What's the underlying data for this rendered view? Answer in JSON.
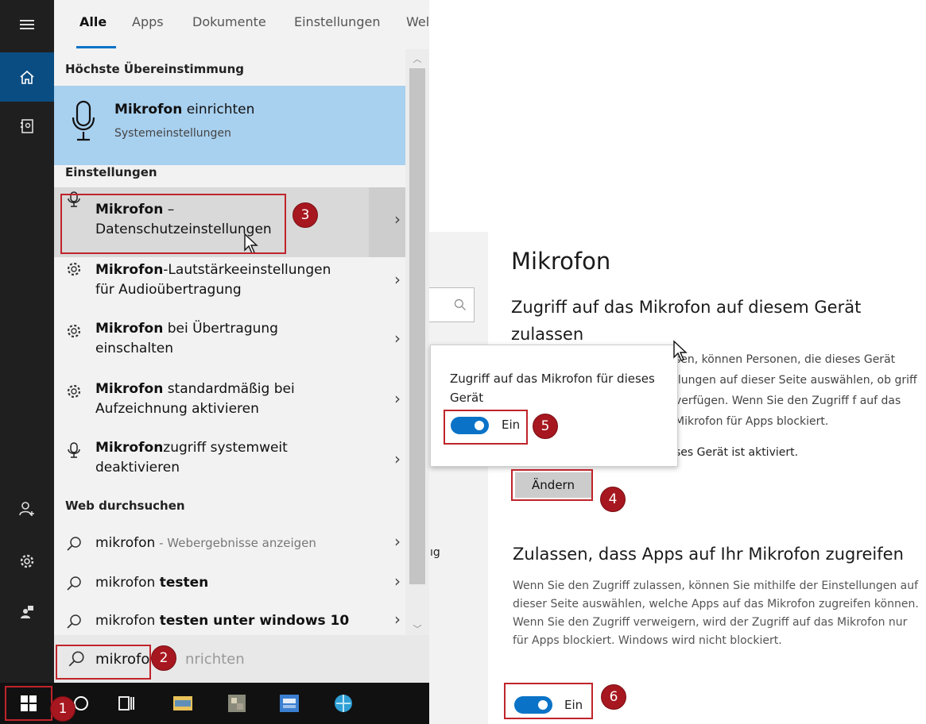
{
  "tabs": [
    {
      "label": "Alle",
      "active": true
    },
    {
      "label": "Apps"
    },
    {
      "label": "Dokumente"
    },
    {
      "label": "Einstellungen"
    },
    {
      "label": "Wel"
    }
  ],
  "best_match": {
    "section": "Höchste Übereinstimmung",
    "title_bold": "Mikrofon",
    "title_rest": " einrichten",
    "subtitle": "Systemeinstellungen",
    "icon": "microphone-icon"
  },
  "settings_section": "Einstellungen",
  "settings_results": [
    {
      "icon": "microphone-icon",
      "bold": "Mikrofon",
      "rest": " –",
      "line2": "Datenschutzeinstellungen"
    },
    {
      "icon": "gear-icon",
      "bold": "Mikrofon",
      "rest": "-Lautstärkeeinstellungen",
      "line2": "für Audioübertragung"
    },
    {
      "icon": "gear-icon",
      "bold": "Mikrofon",
      "rest": " bei Übertragung",
      "line2": "einschalten"
    },
    {
      "icon": "gear-icon",
      "bold": "Mikrofon",
      "rest": " standardmäßig bei",
      "line2": "Aufzeichnung aktivieren"
    },
    {
      "icon": "microphone-icon",
      "bold": "Mikrofon",
      "rest": "zugriff systemweit",
      "line2": "deaktivieren"
    }
  ],
  "web_section": "Web durchsuchen",
  "web_results": [
    {
      "plain": "mikrofon",
      "bold": "",
      "muted": " - Webergebnisse anzeigen"
    },
    {
      "plain": "mikrofon ",
      "bold": "testen",
      "muted": ""
    },
    {
      "plain": "mikrofon ",
      "bold": "testen unter windows 10",
      "muted": ""
    }
  ],
  "search": {
    "typed": "mikrofo",
    "ghost": "nrichten"
  },
  "settings_page": {
    "title": "Mikrofon",
    "heading1": "Zugriff auf das Mikrofon auf diesem Gerät zulassen",
    "para1": "sen, können Personen, die dieses Gerät llungen auf dieser Seite auswählen, ob griff verfügen. Wenn Sie den Zugriff f auf das Mikrofon für Apps blockiert.",
    "status": "ses Gerät ist aktiviert.",
    "change_button": "Ändern",
    "heading2": "Zulassen, dass Apps auf Ihr Mikrofon zugreifen",
    "para2": "Wenn Sie den Zugriff zulassen, können Sie mithilfe der Einstellungen auf dieser Seite auswählen, welche Apps auf das Mikrofon zugreifen können. Wenn Sie den Zugriff verweigern, wird der Zugriff auf das Mikrofon nur für Apps blockiert. Windows wird nicht blockiert.",
    "toggle_label": "Ein",
    "side_fragment": "ıg"
  },
  "popup": {
    "text": "Zugriff auf das Mikrofon für dieses Gerät",
    "toggle_label": "Ein"
  },
  "badges": [
    "1",
    "2",
    "3",
    "4",
    "5",
    "6"
  ],
  "colors": {
    "accent": "#0a73c7",
    "highlight": "#a8d0ef",
    "annotation": "#c0242b"
  }
}
